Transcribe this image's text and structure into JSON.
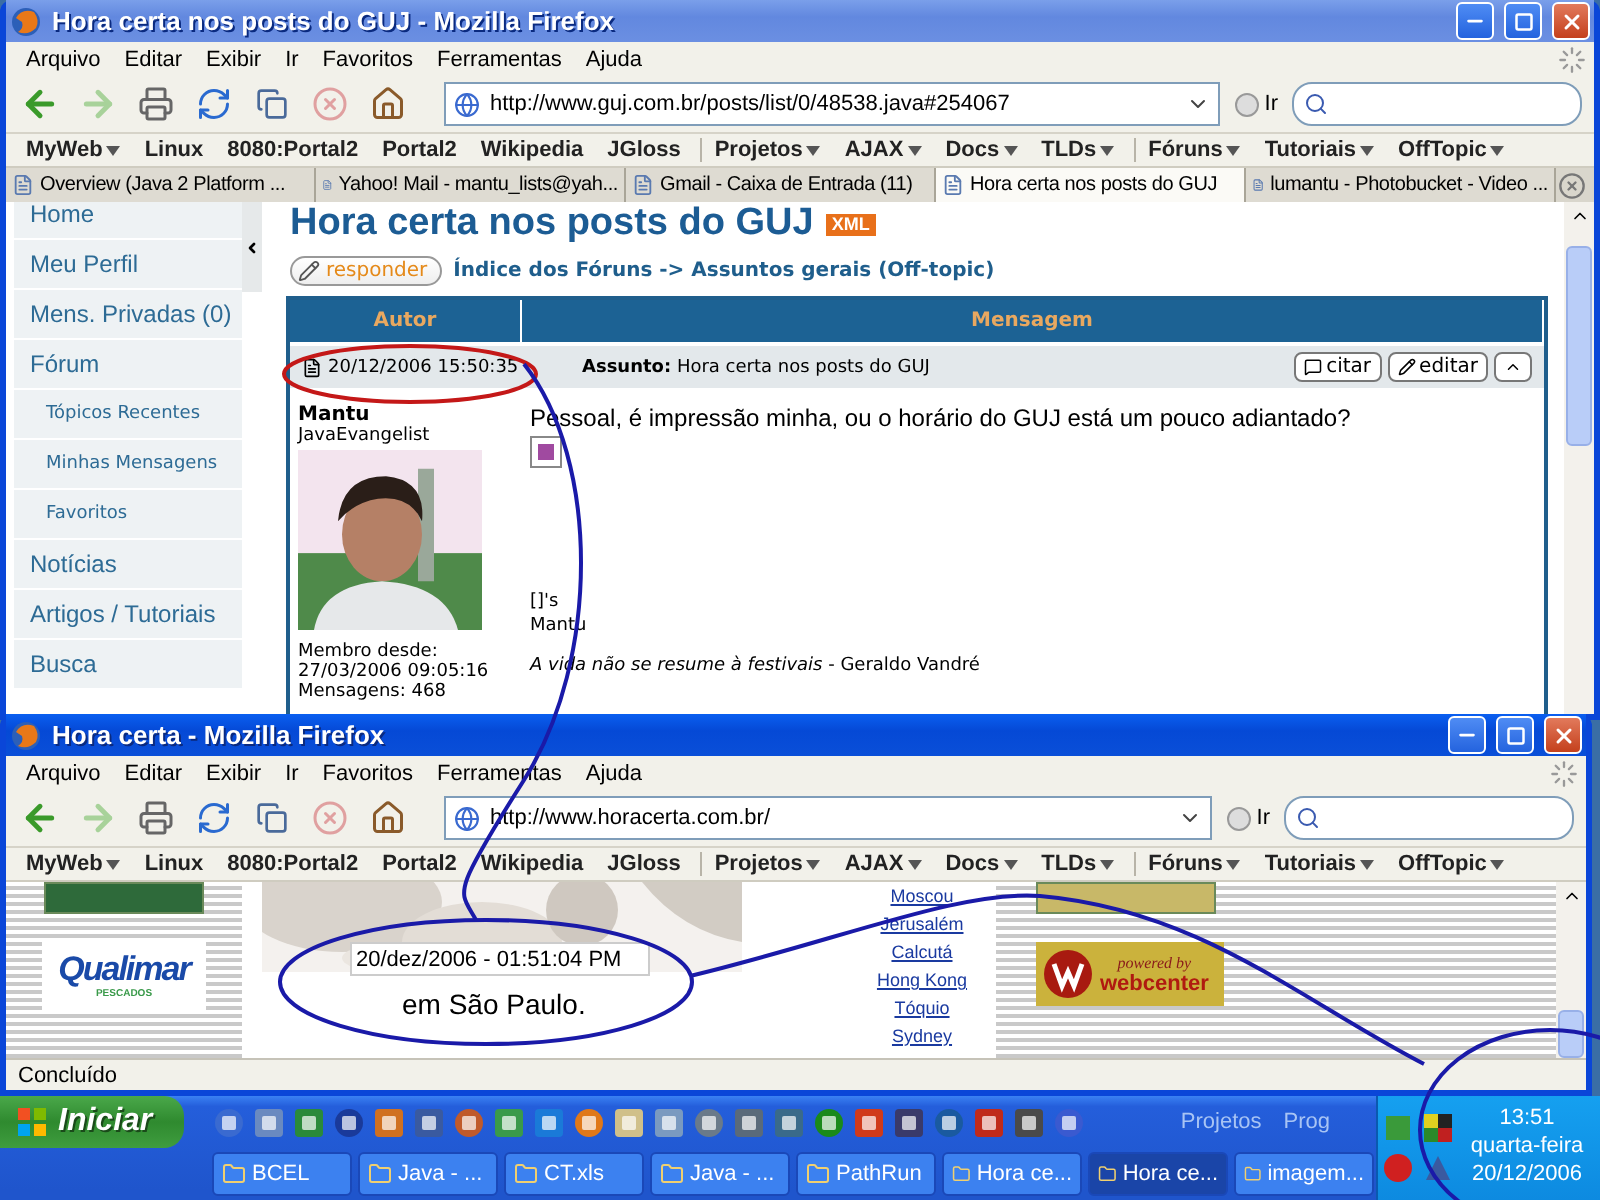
{
  "forum_window": {
    "chrome": {
      "active": false,
      "title": "Hora certa nos posts do GUJ - Mozilla Firefox",
      "menu": [
        "Arquivo",
        "Editar",
        "Exibir",
        "Ir",
        "Favoritos",
        "Ferramentas",
        "Ajuda"
      ],
      "address": "http://www.guj.com.br/posts/list/0/48538.java#254067",
      "go": "Ir",
      "bookmarks": [
        {
          "label": "MyWeb",
          "dropdown": true
        },
        {
          "label": "Linux",
          "dropdown": false
        },
        {
          "label": "8080:Portal2",
          "dropdown": false
        },
        {
          "label": "Portal2",
          "dropdown": false
        },
        {
          "label": "Wikipedia",
          "dropdown": false
        },
        {
          "label": "JGloss",
          "dropdown": false
        },
        {
          "label": "Projetos",
          "dropdown": true
        },
        {
          "label": "AJAX",
          "dropdown": true
        },
        {
          "label": "Docs",
          "dropdown": true
        },
        {
          "label": "TLDs",
          "dropdown": true
        },
        {
          "label": "Fóruns",
          "dropdown": true
        },
        {
          "label": "Tutoriais",
          "dropdown": true
        },
        {
          "label": "OffTopic",
          "dropdown": true
        }
      ]
    },
    "tabs": [
      {
        "label": "Overview (Java 2 Platform ...",
        "selected": false
      },
      {
        "label": "Yahoo! Mail - mantu_lists@yah...",
        "selected": false
      },
      {
        "label": "Gmail - Caixa de Entrada (11)",
        "selected": false
      },
      {
        "label": "Hora certa nos posts do GUJ",
        "selected": true
      },
      {
        "label": "lumantu - Photobucket - Video ...",
        "selected": false
      }
    ],
    "sidebar": [
      {
        "label": "Home",
        "kind": "item"
      },
      {
        "label": "Meu Perfil",
        "kind": "item"
      },
      {
        "label": "Mens. Privadas (0)",
        "kind": "item"
      },
      {
        "label": "Fórum",
        "kind": "item"
      },
      {
        "label": "Tópicos Recentes",
        "kind": "subitem"
      },
      {
        "label": "Minhas Mensagens",
        "kind": "subitem"
      },
      {
        "label": "Favoritos",
        "kind": "subitem"
      },
      {
        "label": "Notícias",
        "kind": "item"
      },
      {
        "label": "Artigos / Tutoriais",
        "kind": "item"
      },
      {
        "label": "Busca",
        "kind": "item"
      }
    ],
    "topic": {
      "title": "Hora certa nos posts do GUJ",
      "feed_badge": "XML",
      "reply_button": "responder",
      "breadcrumb": "Índice dos Fóruns -> Assuntos gerais (Off-topic)",
      "columns": [
        "Autor",
        "Mensagem"
      ]
    },
    "post": {
      "date": "20/12/2006 15:50:35",
      "subject_label": "Assunto:",
      "subject": "Hora certa nos posts do GUJ",
      "actions": [
        "citar",
        "editar"
      ],
      "author": "Mantu",
      "rank": "JavaEvangelist",
      "member_since_label": "Membro desde:",
      "member_since": "27/03/2006 09:05:16",
      "posts": "Mensagens: 468",
      "body": "Pessoal, é impressão minha, ou o horário do GUJ está um pouco adiantado?",
      "closing": [
        "[]'s",
        "Mantu"
      ],
      "signature": "*A vida não se resume à festivais* - Geraldo Vandré"
    }
  },
  "clock_window": {
    "chrome": {
      "active": true,
      "title": "Hora certa - Mozilla Firefox",
      "menu": [
        "Arquivo",
        "Editar",
        "Exibir",
        "Ir",
        "Favoritos",
        "Ferramentas",
        "Ajuda"
      ],
      "address": "http://www.horacerta.com.br/",
      "go": "Ir",
      "bookmarks": [
        {
          "label": "MyWeb",
          "dropdown": true
        },
        {
          "label": "Linux",
          "dropdown": false
        },
        {
          "label": "8080:Portal2",
          "dropdown": false
        },
        {
          "label": "Portal2",
          "dropdown": false
        },
        {
          "label": "Wikipedia",
          "dropdown": false
        },
        {
          "label": "JGloss",
          "dropdown": false
        },
        {
          "label": "Projetos",
          "dropdown": true
        },
        {
          "label": "AJAX",
          "dropdown": true
        },
        {
          "label": "Docs",
          "dropdown": true
        },
        {
          "label": "TLDs",
          "dropdown": true
        },
        {
          "label": "Fóruns",
          "dropdown": true
        },
        {
          "label": "Tutoriais",
          "dropdown": true
        },
        {
          "label": "OffTopic",
          "dropdown": true
        }
      ]
    },
    "sponsor": {
      "name": "Qualimar",
      "tagline": "PESCADOS"
    },
    "time": "20/dez/2006 - 01:51:04 PM",
    "place": "em São Paulo.",
    "cities": [
      "Moscou",
      "Jerusalém",
      "Calcutá",
      "Hong Kong",
      "Tóquio",
      "Sydney"
    ],
    "badge": {
      "top": "powered by",
      "name": "webcenter"
    },
    "status": "Concluído"
  },
  "taskbar": {
    "start": "Iniciar",
    "toolbars": [
      "Projetos",
      "Prog"
    ],
    "tasks": [
      {
        "label": "BCEL",
        "selected": false
      },
      {
        "label": "Java - ...",
        "selected": false
      },
      {
        "label": "CT.xls",
        "selected": false
      },
      {
        "label": "Java - ...",
        "selected": false
      },
      {
        "label": "PathRun",
        "selected": false
      },
      {
        "label": "Hora ce...",
        "selected": false
      },
      {
        "label": "Hora ce...",
        "selected": true
      },
      {
        "label": "imagem...",
        "selected": false
      }
    ],
    "clock": {
      "time": "13:51",
      "day": "quarta-feira",
      "date": "20/12/2006"
    }
  }
}
